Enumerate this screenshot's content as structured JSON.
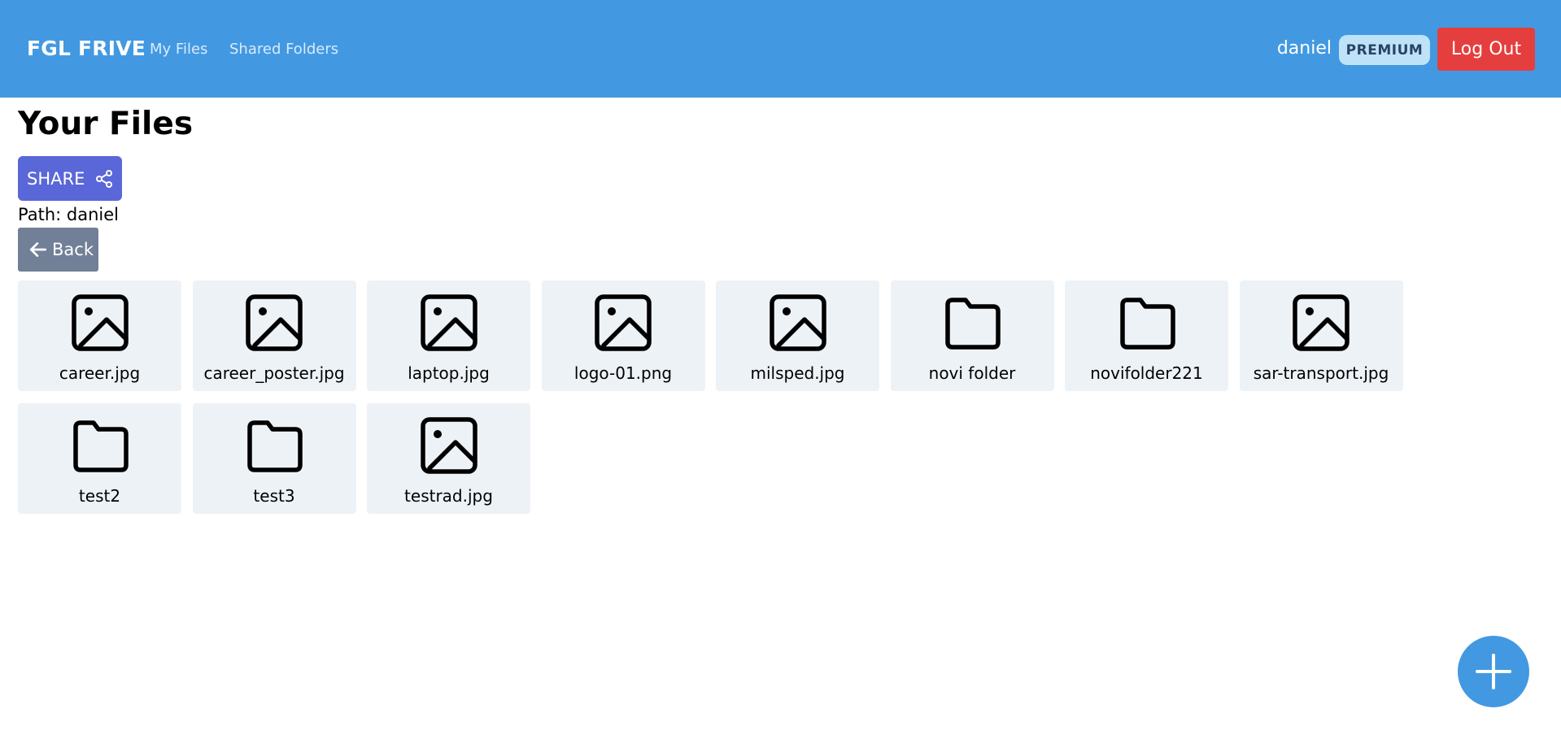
{
  "nav": {
    "brand": "FGL FRIVE",
    "links": [
      "My Files",
      "Shared Folders"
    ],
    "username": "daniel",
    "badge": "PREMIUM",
    "logout": "Log Out"
  },
  "main": {
    "title": "Your Files",
    "share_label": "SHARE",
    "path_label": "Path: daniel",
    "back_label": "Back"
  },
  "files": [
    {
      "name": "career.jpg",
      "icon": "image-icon"
    },
    {
      "name": "career_poster.jpg",
      "icon": "image-icon"
    },
    {
      "name": "laptop.jpg",
      "icon": "image-icon"
    },
    {
      "name": "logo-01.png",
      "icon": "image-icon"
    },
    {
      "name": "milsped.jpg",
      "icon": "image-icon"
    },
    {
      "name": "novi folder",
      "icon": "folder-icon"
    },
    {
      "name": "novifolder221",
      "icon": "folder-icon"
    },
    {
      "name": "sar-transport.jpg",
      "icon": "image-icon"
    },
    {
      "name": "test2",
      "icon": "folder-icon"
    },
    {
      "name": "test3",
      "icon": "folder-icon"
    },
    {
      "name": "testrad.jpg",
      "icon": "image-icon"
    }
  ],
  "fab_icon": "plus-icon",
  "colors": {
    "navbar": "#4299e1",
    "share_button": "#5a67d8",
    "back_button": "#718096",
    "logout_button": "#e53e3e",
    "tile_background": "#edf2f7"
  }
}
